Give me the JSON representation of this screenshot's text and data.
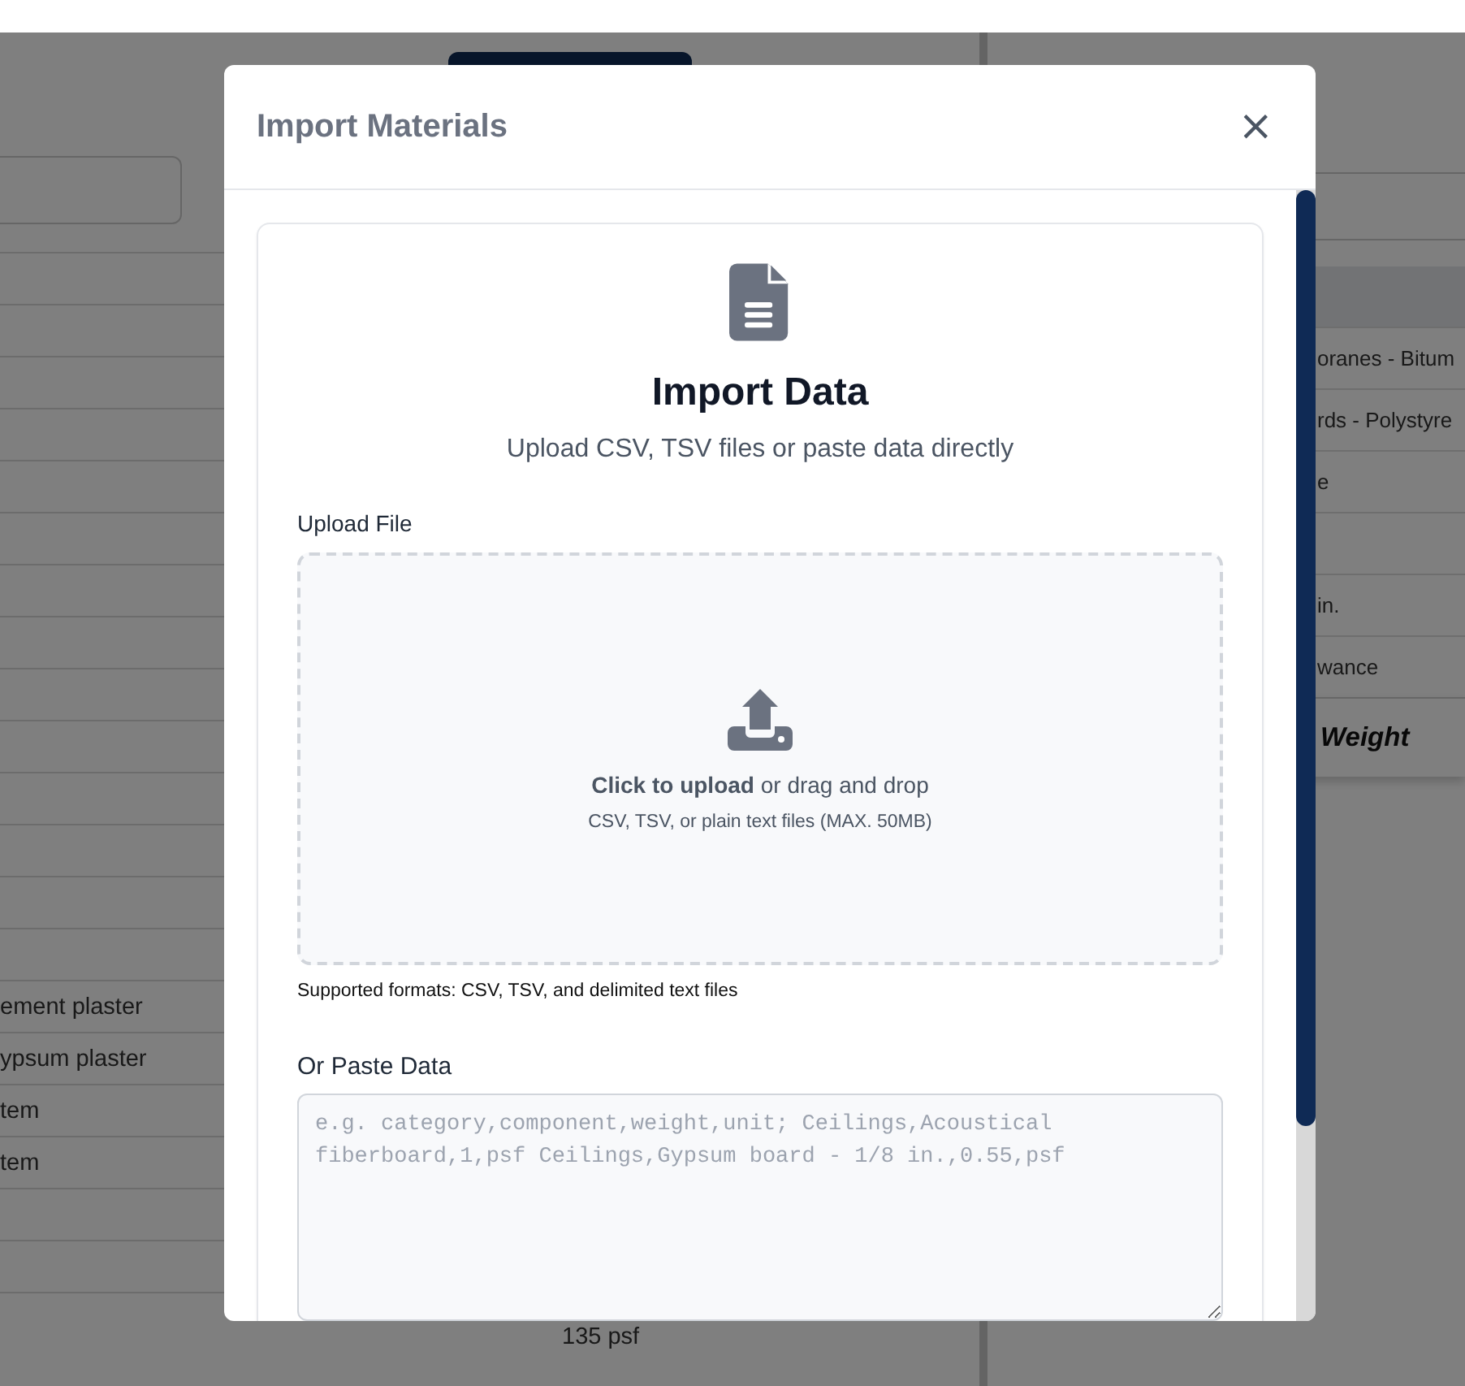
{
  "background": {
    "left_rows": [
      "ement plaster",
      "ypsum plaster",
      "tem",
      "tem"
    ],
    "bottom_value": "135 psf",
    "right_rows": [
      "oranes - Bitum",
      "rds - Polystyre",
      "e",
      "in.",
      "wance"
    ],
    "right_total": "Weight"
  },
  "dialog": {
    "title": "Import Materials",
    "close": "×",
    "heading": "Import Data",
    "subtitle": "Upload CSV, TSV files or paste data directly",
    "upload_label": "Upload File",
    "dropzone": {
      "text": "**Click to upload** or drag and drop",
      "hint": "CSV, TSV, or plain text files (MAX. 50MB)"
    },
    "formats_note": "Supported formats: CSV, TSV, and delimited text files",
    "paste_label": "Or Paste Data",
    "paste_placeholder": "e.g. category,component,weight,unit; Ceilings,Acoustical fiberboard,1,psf Ceilings,Gypsum board - 1/8 in.,0.55,psf"
  }
}
